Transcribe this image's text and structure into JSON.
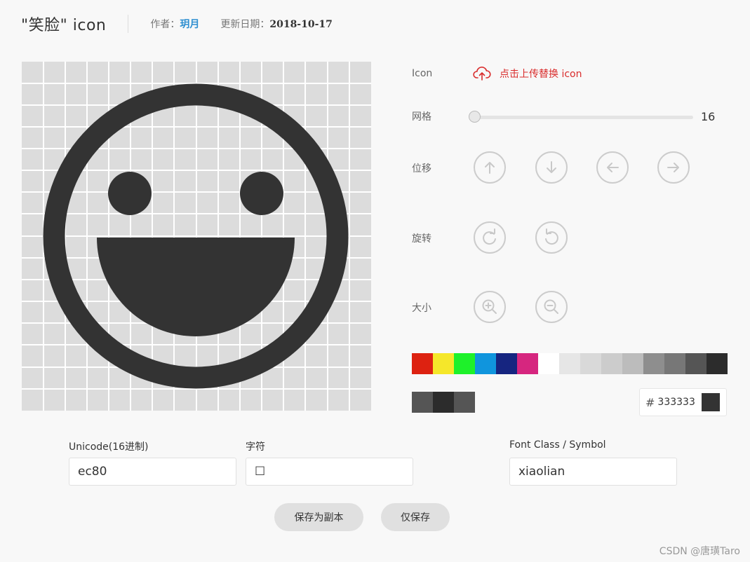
{
  "header": {
    "title": "\"笑脸\" icon",
    "author_label": "作者：",
    "author_name": "玥月",
    "date_label": "更新日期：",
    "date_value": "2018-10-17"
  },
  "icon_preview": {
    "icon_color": "#333333",
    "grid_bg": "#dcdcdc",
    "grid_line": "#ffffff"
  },
  "panel": {
    "icon_label": "Icon",
    "upload_text": "点击上传替换 icon",
    "grid_label": "网格",
    "grid_value": "16",
    "move_label": "位移",
    "move_buttons": [
      "arrow-up-icon",
      "arrow-down-icon",
      "arrow-left-icon",
      "arrow-right-icon"
    ],
    "rotate_label": "旋转",
    "rotate_buttons": [
      "rotate-cw-icon",
      "rotate-ccw-icon"
    ],
    "size_label": "大小",
    "size_buttons": [
      "zoom-in-icon",
      "zoom-out-icon"
    ]
  },
  "palette": {
    "row1": [
      "#dd2211",
      "#f5e72a",
      "#1ef12a",
      "#1095dd",
      "#162580",
      "#d6267f",
      "#ffffff",
      "#e6e6e6",
      "#d9d9d9",
      "#cccccc",
      "#bcbcbc",
      "#8e8e8e",
      "#777777",
      "#555555",
      "#2c2c2c"
    ],
    "row2": [
      "#555555",
      "#2c2c2c",
      "#555555"
    ]
  },
  "color_input": {
    "hash": "#",
    "value": "333333",
    "preview_color": "#333333"
  },
  "fields": {
    "unicode_label": "Unicode(16进制)",
    "unicode_value": "ec80",
    "char_label": "字符",
    "char_value": "☐",
    "fontclass_label": "Font Class / Symbol",
    "fontclass_value": "xiaolian"
  },
  "actions": {
    "save_copy": "保存为副本",
    "save_only": "仅保存"
  },
  "watermark": "CSDN @唐璜Taro"
}
